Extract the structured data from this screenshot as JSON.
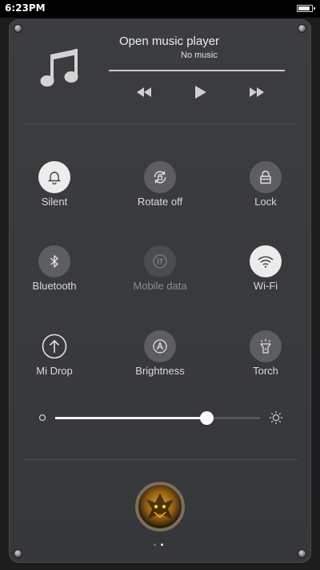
{
  "status_bar": {
    "time": "6:23PM",
    "battery_level": 0.9
  },
  "music": {
    "title": "Open music player",
    "subtitle": "No music",
    "controls": [
      "previous-icon",
      "play-icon",
      "next-icon"
    ]
  },
  "toggles": [
    {
      "label": "Silent",
      "icon": "bell-icon",
      "state": "on"
    },
    {
      "label": "Rotate off",
      "icon": "rotate-lock-icon",
      "state": "off"
    },
    {
      "label": "Lock",
      "icon": "lock-icon",
      "state": "off"
    },
    {
      "label": "Bluetooth",
      "icon": "bluetooth-icon",
      "state": "off"
    },
    {
      "label": "Mobile data",
      "icon": "mobile-data-icon",
      "state": "disabled"
    },
    {
      "label": "Wi-Fi",
      "icon": "wifi-icon",
      "state": "on"
    },
    {
      "label": "Mi Drop",
      "icon": "mi-drop-icon",
      "state": "off"
    },
    {
      "label": "Brightness",
      "icon": "auto-brightness-icon",
      "state": "off"
    },
    {
      "label": "Torch",
      "icon": "torch-icon",
      "state": "off"
    }
  ],
  "brightness": {
    "level": 0.74
  },
  "pager": {
    "pages": 2,
    "current": 2
  },
  "colors": {
    "panel": "#3a3c3f",
    "active_toggle": "#ececec",
    "inactive_toggle": "#5c5e62",
    "text": "#e6e6e6"
  }
}
